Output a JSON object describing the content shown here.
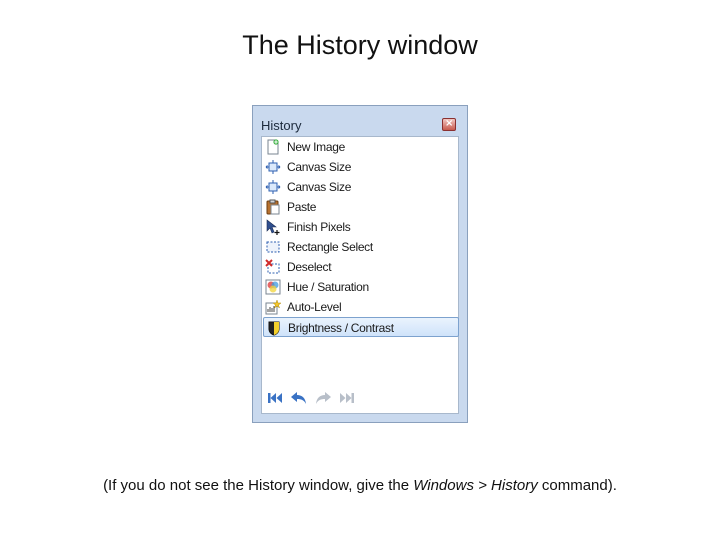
{
  "slide": {
    "title": "The History window",
    "caption": {
      "before": "(If you do not see the History window, give the ",
      "command": "Windows > History",
      "after": " command)."
    }
  },
  "window": {
    "title": "History",
    "close_icon": "close-icon",
    "items": [
      {
        "label": "New Image",
        "icon": "new-image-icon"
      },
      {
        "label": "Canvas Size",
        "icon": "canvas-size-icon"
      },
      {
        "label": "Canvas Size",
        "icon": "canvas-size-icon"
      },
      {
        "label": "Paste",
        "icon": "paste-icon"
      },
      {
        "label": "Finish Pixels",
        "icon": "finish-pixels-icon"
      },
      {
        "label": "Rectangle Select",
        "icon": "rectangle-select-icon"
      },
      {
        "label": "Deselect",
        "icon": "deselect-icon"
      },
      {
        "label": "Hue / Saturation",
        "icon": "hue-saturation-icon"
      },
      {
        "label": "Auto-Level",
        "icon": "auto-level-icon"
      },
      {
        "label": "Brightness / Contrast",
        "icon": "brightness-contrast-icon",
        "selected": true
      }
    ],
    "toolbar": [
      "rewind-to-start-icon",
      "undo-icon",
      "redo-icon",
      "fast-forward-to-end-icon"
    ]
  },
  "colors": {
    "window_frame": "#c9d9ee",
    "selection": "#cfe3fa",
    "toolbar_active": "#3a72c4",
    "toolbar_disabled": "#b8bfc9"
  }
}
